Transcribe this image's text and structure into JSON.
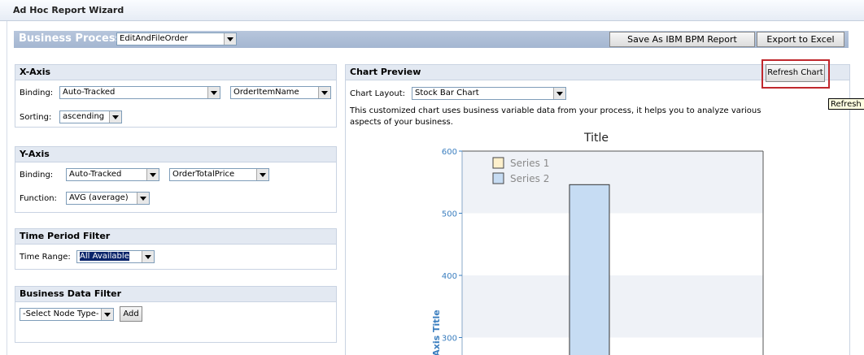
{
  "window": {
    "title": "Ad Hoc Report Wizard"
  },
  "business_process": {
    "label": "Business Process",
    "value": "EditAndFileOrder",
    "save_button": "Save As IBM BPM Report",
    "export_button": "Export to Excel"
  },
  "xaxis": {
    "title": "X-Axis",
    "binding_label": "Binding:",
    "binding_value": "Auto-Tracked",
    "field_value": "OrderItemName",
    "sorting_label": "Sorting:",
    "sorting_value": "ascending"
  },
  "yaxis": {
    "title": "Y-Axis",
    "binding_label": "Binding:",
    "binding_value": "Auto-Tracked",
    "field_value": "OrderTotalPrice",
    "function_label": "Function:",
    "function_value": "AVG (average)"
  },
  "time_filter": {
    "title": "Time Period Filter",
    "range_label": "Time Range:",
    "range_value": "All Available"
  },
  "data_filter": {
    "title": "Business Data Filter",
    "node_type": "-Select Node Type-",
    "add_label": "Add"
  },
  "preview": {
    "title": "Chart Preview",
    "layout_label": "Chart Layout:",
    "layout_value": "Stock Bar Chart",
    "refresh_label": "Refresh Chart",
    "tooltip": "Refresh",
    "description_line1": "This customized chart uses business variable data from your process, it helps you to analyze various",
    "description_line2": "aspects of your business."
  },
  "chart_data": {
    "type": "bar",
    "title": "Title",
    "ylabel": "Axis Title",
    "ylim": [
      250,
      600
    ],
    "yticks": [
      600,
      500,
      400,
      300
    ],
    "grid": "alternating horizontal bands",
    "legend_position": "top-left",
    "series": [
      {
        "name": "Series 1",
        "color": "#fdf0cc",
        "values": []
      },
      {
        "name": "Series 2",
        "color": "#c6dcf3",
        "values": [
          546
        ]
      }
    ]
  },
  "colors": {
    "panel_header": "#e3e9f2",
    "bp_bar": "#a9bad3",
    "axis_blue": "#3a7ebf",
    "highlight_red": "#c0282d"
  }
}
